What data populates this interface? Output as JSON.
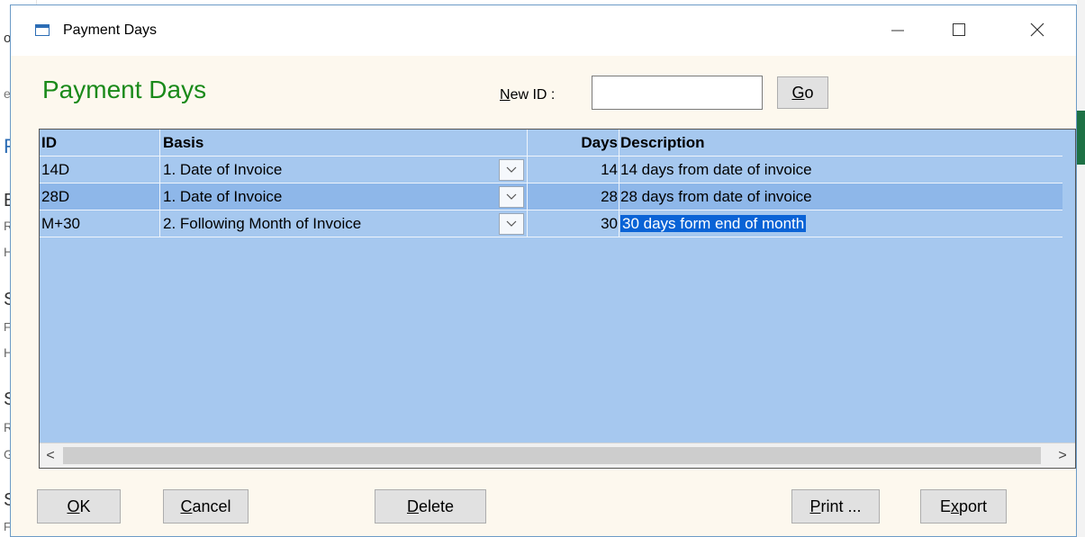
{
  "background_app": {
    "fragments": [
      "o",
      "ea",
      "F",
      "B",
      "R",
      "H",
      "S",
      "F\\",
      "H",
      "S",
      "R",
      "G",
      "S",
      "F\\"
    ]
  },
  "window": {
    "title": "Payment Days",
    "minimize_icon": "minimize-icon",
    "maximize_icon": "maximize-icon",
    "close_icon": "close-icon"
  },
  "header": {
    "heading": "Payment Days",
    "new_id_label": "New ID :",
    "new_id_value": "",
    "go_label": "Go"
  },
  "grid": {
    "columns": [
      "ID",
      "Basis",
      "Days",
      "Description"
    ],
    "rows": [
      {
        "id": "14D",
        "basis": "1. Date of Invoice",
        "days": "14",
        "description": "14 days from date of invoice"
      },
      {
        "id": "28D",
        "basis": "1. Date of Invoice",
        "days": "28",
        "description": "28 days from date of invoice"
      },
      {
        "id": "M+30",
        "basis": "2. Following Month of Invoice",
        "days": "30",
        "description": "30 days form end of month"
      }
    ],
    "selected_row": 1,
    "highlighted_cell": "row 3 description",
    "scroll_left_glyph": "<",
    "scroll_right_glyph": ">"
  },
  "footer": {
    "ok_label": "OK",
    "cancel_label": "Cancel",
    "delete_label": "Delete",
    "print_label": "Print ...",
    "export_label": "Export"
  },
  "colors": {
    "heading": "#1a8a1a",
    "grid_bg": "#a6c8ef",
    "selected_row": "#8eb7e9",
    "cell_highlight": "#0a63d6"
  }
}
